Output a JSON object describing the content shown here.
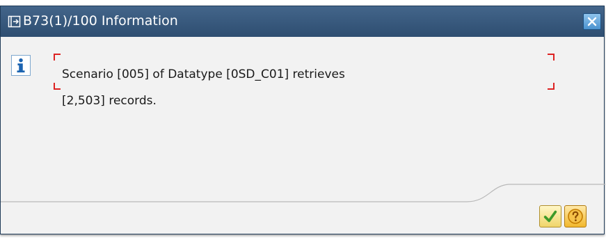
{
  "window": {
    "title": "B73(1)/100 Information",
    "title_icon": "dialog-icon",
    "close_icon": "close-icon"
  },
  "message": {
    "icon": "info-icon",
    "line1": "Scenario [005] of Datatype [0SD_C01] retrieves",
    "line2": "[2,503] records."
  },
  "buttons": {
    "ok_icon": "checkmark-icon",
    "help_icon": "question-icon"
  },
  "colors": {
    "titlebar": "#2e4e71",
    "focus_corner": "#dd2222",
    "ok_check": "#3d9a2a",
    "help": "#f2b82e"
  }
}
